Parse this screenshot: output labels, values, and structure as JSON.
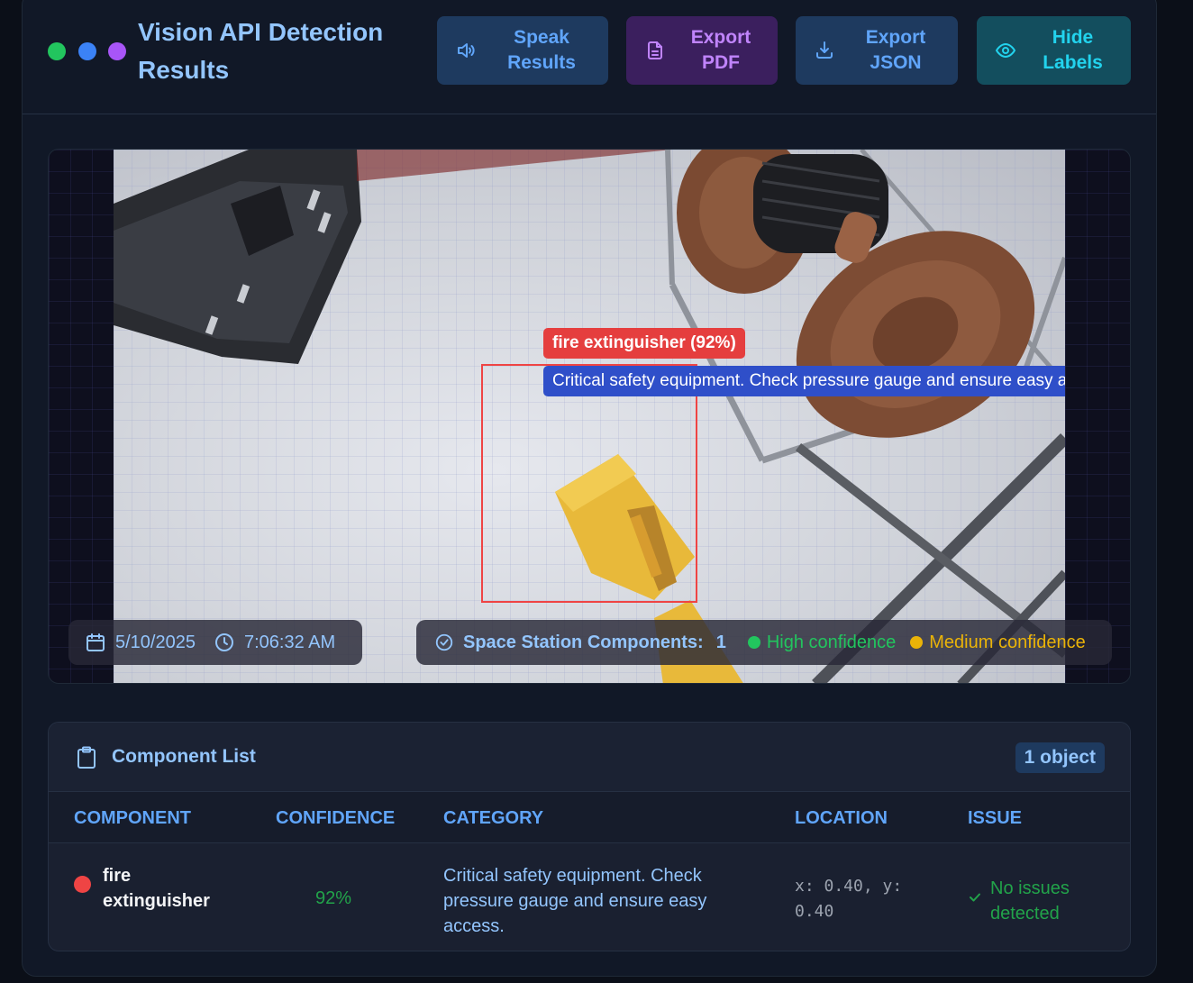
{
  "header": {
    "title": "Vision API Detection Results",
    "buttons": {
      "speak": "Speak Results",
      "export_pdf": "Export PDF",
      "export_json": "Export JSON",
      "hide_labels": "Hide Labels"
    }
  },
  "viewer": {
    "detection": {
      "label": "fire extinguisher (92%)",
      "description": "Critical safety equipment. Check pressure gauge and ensure easy access."
    },
    "date": "5/10/2025",
    "time": "7:06:32 AM",
    "stats": {
      "label": "Space Station Components:",
      "count": "1",
      "legend_high": "High confidence",
      "legend_medium": "Medium confidence"
    }
  },
  "component_list": {
    "title": "Component List",
    "badge": "1 object",
    "columns": [
      "Component",
      "Confidence",
      "Category",
      "Location",
      "Issue"
    ],
    "rows": [
      {
        "component": "fire extinguisher",
        "confidence": "92%",
        "category": "Critical safety equipment. Check pressure gauge and ensure easy access.",
        "location": "x: 0.40, y: 0.40",
        "issue": "No issues detected"
      }
    ]
  },
  "colors": {
    "accent_blue": "#60a5fa",
    "accent_purple": "#c084fc",
    "accent_cyan": "#22d3ee",
    "detection_red": "#ef4444",
    "high_confidence": "#22c55e",
    "medium_confidence": "#eab308"
  },
  "icons": {
    "speak": "speaker-icon",
    "pdf": "file-icon",
    "json": "download-icon",
    "hide": "eye-icon",
    "date": "calendar-icon",
    "time": "clock-icon",
    "stats": "check-circle-icon",
    "list": "clipboard-icon",
    "issue": "check-icon"
  }
}
